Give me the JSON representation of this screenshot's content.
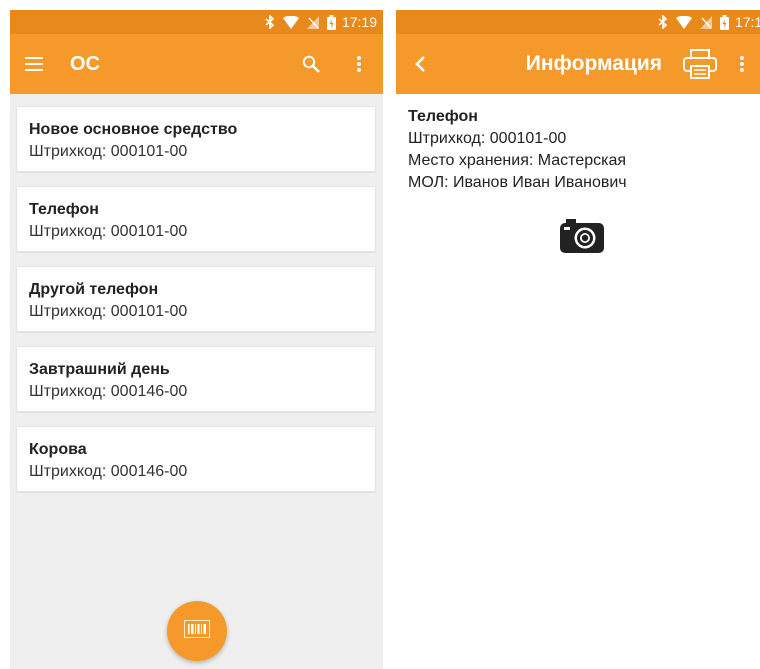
{
  "status_bar": {
    "time": "17:19"
  },
  "left_screen": {
    "toolbar": {
      "title": "ОС"
    },
    "items": [
      {
        "title": "Новое основное средство",
        "barcode": "Штрихкод: 000101-00"
      },
      {
        "title": "Телефон",
        "barcode": "Штрихкод: 000101-00"
      },
      {
        "title": "Другой телефон",
        "barcode": "Штрихкод: 000101-00"
      },
      {
        "title": "Завтрашний день",
        "barcode": "Штрихкод: 000146-00"
      },
      {
        "title": "Корова",
        "barcode": "Штрихкод: 000146-00"
      }
    ]
  },
  "right_screen": {
    "toolbar": {
      "title": "Информация"
    },
    "info": {
      "title": "Телефон",
      "barcode": "Штрихкод: 000101-00",
      "location": "Место хранения: Мастерская",
      "mol": "МОЛ: Иванов Иван Иванович"
    }
  },
  "colors": {
    "toolbar": "#f59a2a",
    "status_bar": "#e8891c",
    "list_background": "#efefef"
  },
  "icons": [
    "bluetooth-icon",
    "wifi-icon",
    "no-sim-icon",
    "battery-icon",
    "menu-icon",
    "search-icon",
    "more-vert-icon",
    "back-arrow-icon",
    "print-icon",
    "camera-icon",
    "barcode-scan-icon"
  ]
}
